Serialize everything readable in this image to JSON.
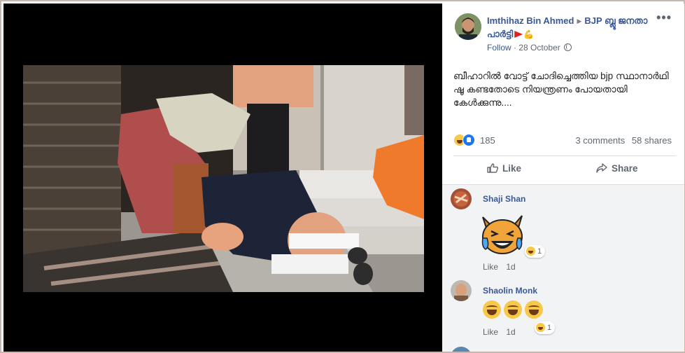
{
  "post": {
    "author": "Imthihaz Bin Ahmed",
    "group": "BJP ബ്ലൂ ജനതാ പാർട്ടി",
    "follow_label": "Follow",
    "date": "28 October",
    "text": "ബീഹാറിൽ വോട്ട് ചോദിച്ചെത്തിയ bjp സ്ഥാനാർഥി ഷൂ കണ്ടതോടെ നിയന്ത്രണം പോയതായി കേൾക്കുന്നു....",
    "reaction_count": "185",
    "comments_count": "3 comments",
    "shares_count": "58 shares",
    "like_label": "Like",
    "share_label": "Share",
    "more_label": "•••"
  },
  "comments": [
    {
      "name": "Shaji Shan",
      "like_label": "Like",
      "time": "1d",
      "reaction_count": "1"
    },
    {
      "name": "Shaolin Monk",
      "like_label": "Like",
      "time": "1d",
      "reaction_count": "1"
    }
  ],
  "icons": {
    "reaction_haha": "haha-reaction-icon",
    "reaction_like": "like-reaction-icon",
    "like_action": "thumbs-up-icon",
    "share_action": "share-arrow-icon",
    "privacy": "globe-icon"
  },
  "colors": {
    "link_blue": "#385898",
    "meta_gray": "#606770",
    "media_background": "#000000",
    "comment_background": "#f2f3f5"
  }
}
